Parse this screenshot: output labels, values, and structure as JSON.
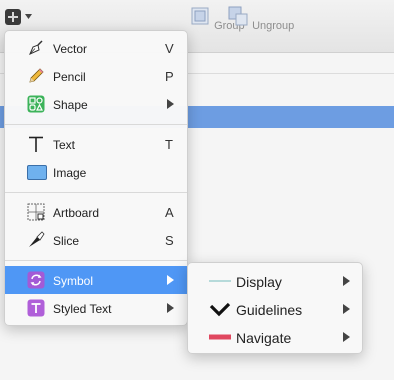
{
  "toolbar": {
    "insert_icon": "plus-icon",
    "group_label": "Group",
    "ungroup_label": "Ungroup"
  },
  "menu": {
    "items": [
      {
        "label": "Vector",
        "shortcut": "V",
        "icon": "pen-icon"
      },
      {
        "label": "Pencil",
        "shortcut": "P",
        "icon": "pencil-icon"
      },
      {
        "label": "Shape",
        "shortcut": "",
        "icon": "shape-icon",
        "submenu": true
      },
      {
        "label": "Text",
        "shortcut": "T",
        "icon": "text-icon"
      },
      {
        "label": "Image",
        "shortcut": "",
        "icon": "image-icon"
      },
      {
        "label": "Artboard",
        "shortcut": "A",
        "icon": "artboard-icon"
      },
      {
        "label": "Slice",
        "shortcut": "S",
        "icon": "slice-icon"
      },
      {
        "label": "Symbol",
        "shortcut": "",
        "icon": "symbol-icon",
        "submenu": true,
        "active": true
      },
      {
        "label": "Styled Text",
        "shortcut": "",
        "icon": "styled-text-icon",
        "submenu": true
      }
    ]
  },
  "submenu": {
    "items": [
      {
        "label": "Display",
        "icon": "display-line-icon"
      },
      {
        "label": "Guidelines",
        "icon": "checkmark-icon"
      },
      {
        "label": "Navigate",
        "icon": "navigate-bar-icon"
      }
    ]
  },
  "colors": {
    "highlight": "#4f97f5",
    "selected_row": "#6d9de2",
    "shape_icon": "#3cb35a",
    "symbol_icon": "#a35ad6",
    "navigate_bar": "#e0475f"
  }
}
